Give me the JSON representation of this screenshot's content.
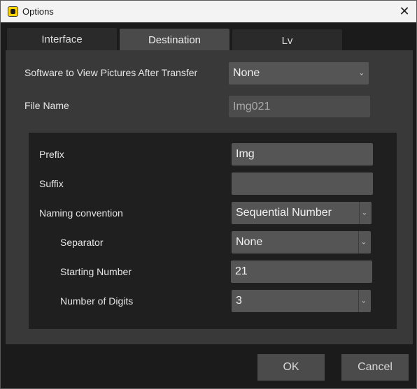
{
  "window": {
    "title": "Options",
    "close_icon": "close-icon",
    "app_icon": "app-icon"
  },
  "tabs": [
    {
      "label": "Interface",
      "active": false
    },
    {
      "label": "Destination",
      "active": true
    },
    {
      "label": "Lv",
      "active": false
    }
  ],
  "destination": {
    "software_label": "Software to View Pictures After Transfer",
    "software_value": "None",
    "file_name_label": "File Name",
    "file_name_value": "Img021"
  },
  "naming": {
    "prefix_label": "Prefix",
    "prefix_value": "Img",
    "suffix_label": "Suffix",
    "suffix_value": "",
    "convention_label": "Naming convention",
    "convention_value": "Sequential Number",
    "separator_label": "Separator",
    "separator_value": "None",
    "starting_number_label": "Starting Number",
    "starting_number_value": "21",
    "digits_label": "Number of Digits",
    "digits_value": "3"
  },
  "footer": {
    "ok_label": "OK",
    "cancel_label": "Cancel"
  }
}
